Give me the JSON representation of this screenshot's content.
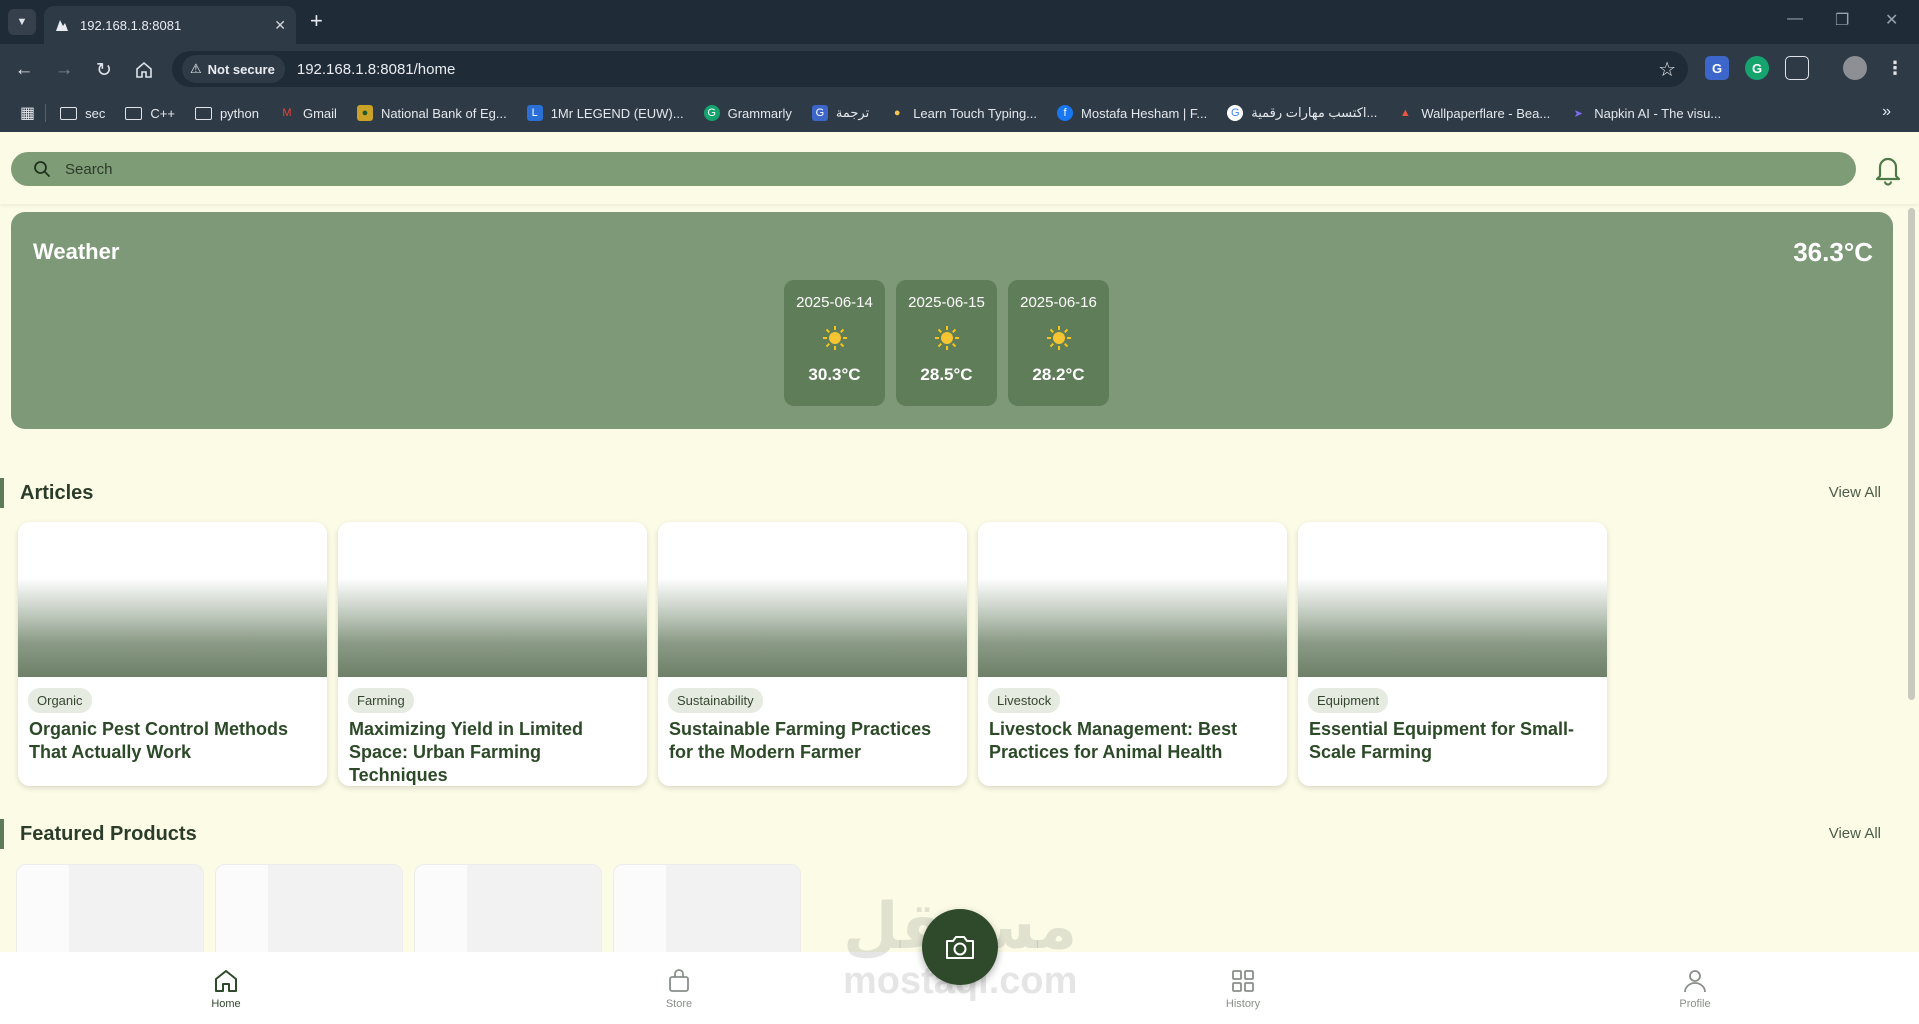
{
  "browser": {
    "tab_title": "192.168.1.8:8081",
    "security_label": "Not secure",
    "url": "192.168.1.8:8081/home",
    "bookmarks": [
      "sec",
      "C++",
      "python",
      "Gmail",
      "National Bank of Eg...",
      "1Mr LEGEND (EUW)...",
      "Grammarly",
      "ترجمة",
      "Learn Touch Typing...",
      "Mostafa Hesham | F...",
      "اكتسب مهارات رقمية...",
      "Wallpaperflare - Bea...",
      "Napkin AI - The visu..."
    ]
  },
  "header": {
    "search_placeholder": "Search"
  },
  "weather": {
    "title": "Weather",
    "current_temp": "36.3°C",
    "forecast": [
      {
        "date": "2025-06-14",
        "icon": "sun-icon",
        "temp": "30.3°C"
      },
      {
        "date": "2025-06-15",
        "icon": "sun-icon",
        "temp": "28.5°C"
      },
      {
        "date": "2025-06-16",
        "icon": "sun-icon",
        "temp": "28.2°C"
      }
    ]
  },
  "articles": {
    "title": "Articles",
    "view_all": "View All",
    "items": [
      {
        "tag": "Organic",
        "title": "Organic Pest Control Methods That Actually Work"
      },
      {
        "tag": "Farming",
        "title": "Maximizing Yield in Limited Space: Urban Farming Techniques"
      },
      {
        "tag": "Sustainability",
        "title": "Sustainable Farming Practices for the Modern Farmer"
      },
      {
        "tag": "Livestock",
        "title": "Livestock Management: Best Practices for Animal Health"
      },
      {
        "tag": "Equipment",
        "title": "Essential Equipment for Small-Scale Farming"
      }
    ]
  },
  "products": {
    "title": "Featured Products",
    "view_all": "View All"
  },
  "watermark": {
    "line1": "مستقل",
    "line2": "mostaql.com"
  },
  "nav": {
    "home": "Home",
    "store": "Store",
    "history": "History",
    "profile": "Profile"
  },
  "colors": {
    "primary": "#2f4a2b",
    "weather_bg": "#7d9977",
    "search_bg": "#7e9d76",
    "page_bg": "#fbfbe6"
  }
}
